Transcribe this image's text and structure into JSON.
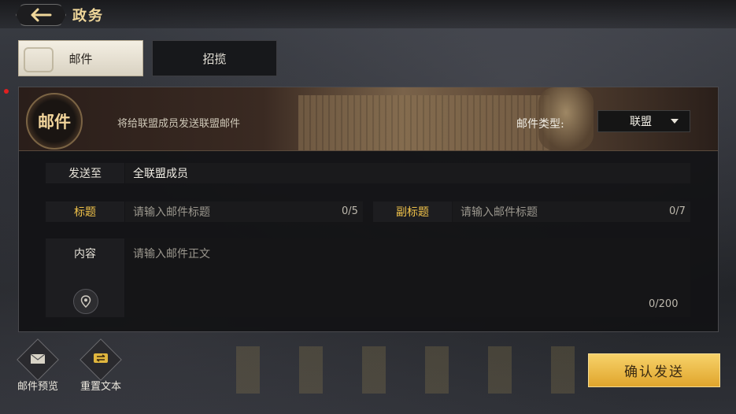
{
  "header": {
    "title": "政务",
    "back_icon": "arrow-left-icon"
  },
  "tabs": [
    {
      "label": "邮件",
      "active": true
    },
    {
      "label": "招揽",
      "active": false
    }
  ],
  "banner": {
    "seal_text": "邮件",
    "description": "将给联盟成员发送联盟邮件",
    "mail_type_label": "邮件类型:",
    "mail_type_value": "联盟"
  },
  "form": {
    "send_to_label": "发送至",
    "send_to_value": "全联盟成员",
    "title_label": "标题",
    "title_placeholder": "请输入邮件标题",
    "title_counter": "0/5",
    "subtitle_label": "副标题",
    "subtitle_placeholder": "请输入邮件标题",
    "subtitle_counter": "0/7",
    "content_label": "内容",
    "content_placeholder": "请输入邮件正文",
    "content_counter": "0/200",
    "location_icon": "location-pin-icon"
  },
  "footer": {
    "preview_label": "邮件预览",
    "reset_label": "重置文本",
    "confirm_label": "确认发送"
  },
  "colors": {
    "accent_gold": "#f0c24a",
    "confirm_bg": "#f0c050"
  }
}
